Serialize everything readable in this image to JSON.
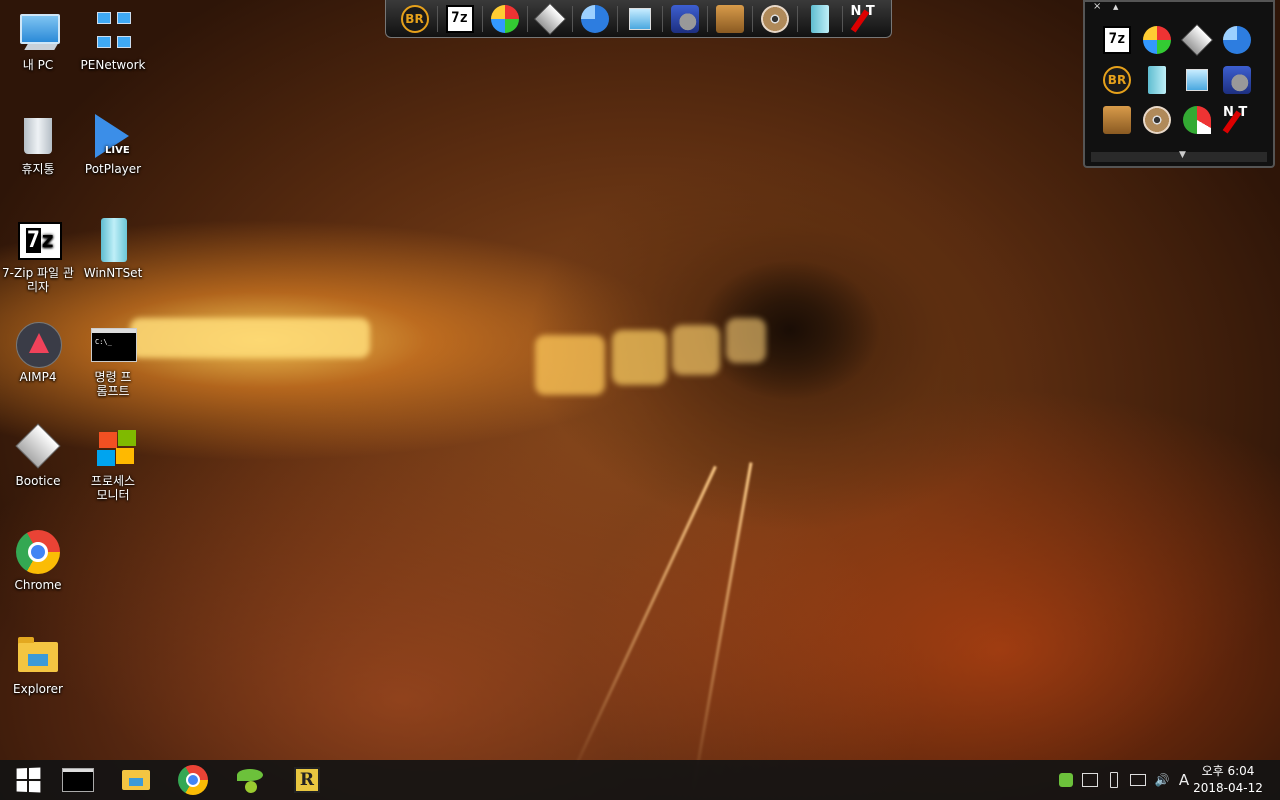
{
  "desktop": {
    "icons": [
      {
        "label": "내 PC",
        "name": "this-pc-icon"
      },
      {
        "label": "PENetwork",
        "name": "pe-network-icon"
      },
      {
        "label": "휴지통",
        "name": "recycle-bin-icon"
      },
      {
        "label": "PotPlayer",
        "name": "potplayer-icon"
      },
      {
        "label": "7-Zip 파일 관리자",
        "name": "7zip-icon"
      },
      {
        "label": "WinNTSet",
        "name": "winntset-icon"
      },
      {
        "label": "AIMP4",
        "name": "aimp4-icon"
      },
      {
        "label": "명령 프롬프트",
        "name": "command-prompt-icon"
      },
      {
        "label": "Bootice",
        "name": "bootice-icon"
      },
      {
        "label": "프로세스 모니터",
        "name": "process-monitor-icon"
      },
      {
        "label": "Chrome",
        "name": "chrome-icon"
      },
      {
        "label": "Explorer",
        "name": "explorer-icon"
      }
    ],
    "potplayer_badge": "LIVE",
    "cmd_prompt_text": "C:\\_"
  },
  "launcher": {
    "items": [
      "br-icon",
      "7zip-icon",
      "partition-icon",
      "bootice-icon",
      "disk-usage-icon",
      "monitor-icon",
      "network-settings-icon",
      "package-icon",
      "cd-icon",
      "winntset-icon",
      "ntpwedit-icon"
    ],
    "br_text": "BR",
    "sevenz_text": "7z",
    "nt_text": "N T"
  },
  "panel": {
    "close_glyph": "×",
    "up_glyph": "▲",
    "down_glyph": "▼",
    "items": [
      "7zip-icon",
      "partition-icon",
      "bootice-icon",
      "disk-usage-icon",
      "br-icon",
      "winntset-icon",
      "monitor-icon",
      "network-settings-icon",
      "package-icon",
      "cd-icon",
      "pie-chart-icon",
      "ntpwedit-icon"
    ]
  },
  "taskbar": {
    "buttons": [
      "start-button",
      "command-prompt-button",
      "file-explorer-button",
      "chrome-button",
      "app-leaf-button",
      "app-r-button"
    ],
    "r_letter": "R",
    "ime_indicator": "A",
    "clock_time": "오후 6:04",
    "clock_date": "2018-04-12"
  },
  "colors": {
    "taskbar": "#141414",
    "accent_blue": "#3c9ad8"
  }
}
